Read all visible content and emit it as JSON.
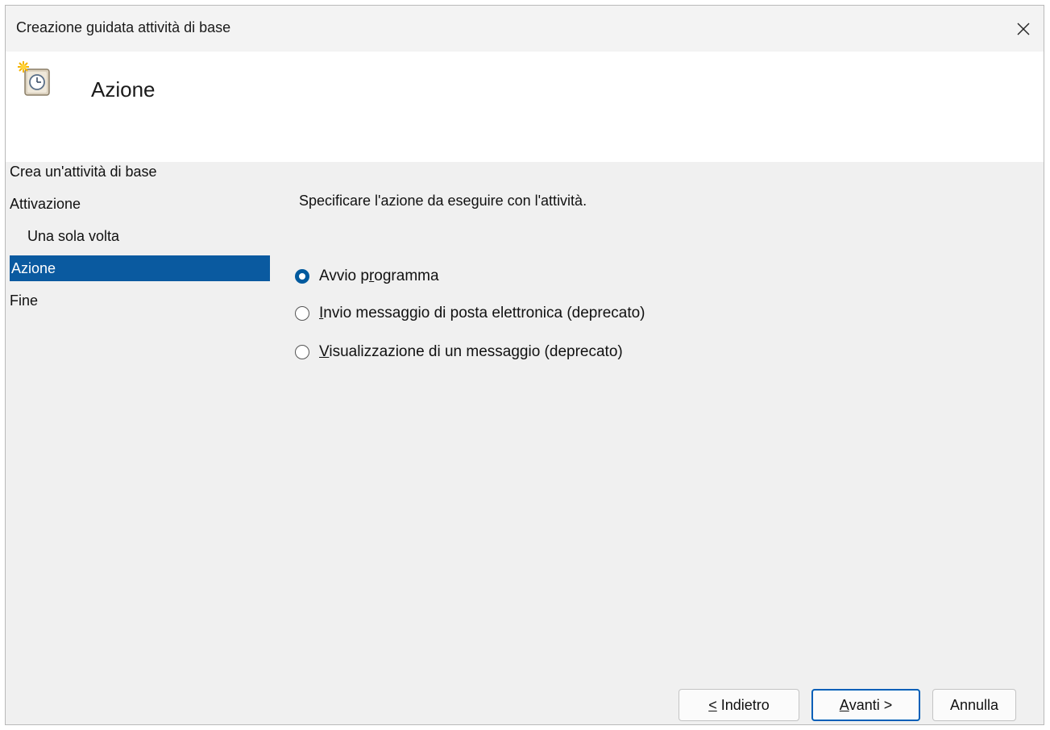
{
  "window": {
    "title": "Creazione guidata attività di base"
  },
  "header": {
    "title": "Azione",
    "icon": "scheduled-task-clock-icon"
  },
  "nav": {
    "items": [
      {
        "label": "Crea un'attività di base"
      },
      {
        "label": "Attivazione"
      },
      {
        "label": "Una sola volta"
      },
      {
        "label": "Azione"
      },
      {
        "label": "Fine"
      }
    ],
    "selected": "Azione"
  },
  "content": {
    "description": "Specificare l'azione da eseguire con l'attività.",
    "options": [
      {
        "pre": "Avvio p",
        "accel": "r",
        "post": "ogramma",
        "checked": true
      },
      {
        "pre": "",
        "accel": "I",
        "post": "nvio messaggio di posta elettronica (deprecato)",
        "checked": false
      },
      {
        "pre": "",
        "accel": "V",
        "post": "isualizzazione di un messaggio (deprecato)",
        "checked": false
      }
    ]
  },
  "buttons": {
    "back": {
      "accel": "<",
      "rest": " Indietro"
    },
    "next": {
      "accel": "A",
      "rest": "vanti >"
    },
    "cancel": {
      "label": "Annulla"
    }
  },
  "colors": {
    "selection": "#0a5aa0",
    "accent": "#005fb8"
  }
}
